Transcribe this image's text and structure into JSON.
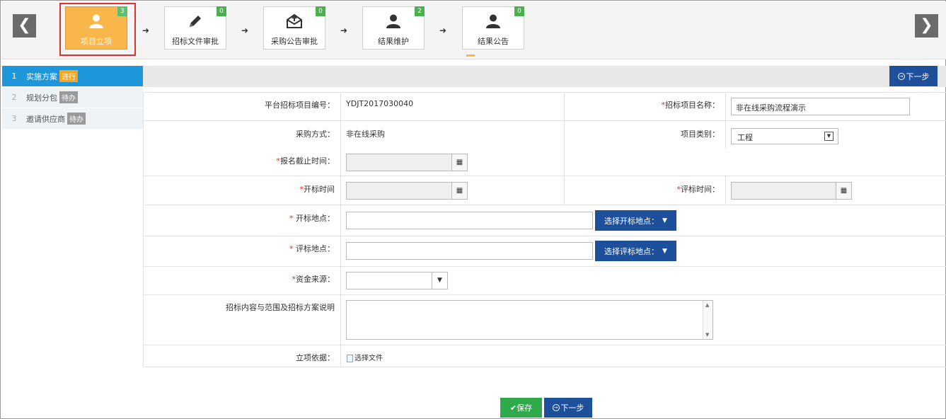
{
  "nav": {
    "prev": "❮",
    "next": "❯"
  },
  "steps": [
    {
      "label": "项目立项",
      "badge": "3",
      "icon": "user-icon",
      "active": true
    },
    {
      "label": "招标文件审批",
      "badge": "0",
      "icon": "pencil-icon",
      "active": false
    },
    {
      "label": "采购公告审批",
      "badge": "0",
      "icon": "envelope-icon",
      "active": false
    },
    {
      "label": "结果维护",
      "badge": "2",
      "icon": "user-icon",
      "active": false
    },
    {
      "label": "结果公告",
      "badge": "0",
      "icon": "user-icon",
      "active": false
    }
  ],
  "step_arrow": "➜",
  "sidebar": {
    "items": [
      {
        "num": "1",
        "label": "实施方案",
        "status": "进行",
        "active": true
      },
      {
        "num": "2",
        "label": "规划分包",
        "status": "待办",
        "active": false
      },
      {
        "num": "3",
        "label": "邀请供应商",
        "status": "待办",
        "active": false
      }
    ]
  },
  "actions": {
    "next": "下一步",
    "save": "保存",
    "next_icon": "→",
    "save_icon": "✔"
  },
  "form": {
    "project_no": {
      "label": "平台招标项目编号：",
      "value": "YDJT2017030040"
    },
    "project_name": {
      "label": "招标项目名称：",
      "value": "非在线采购流程演示"
    },
    "purchase_method": {
      "label": "采购方式：",
      "value": "非在线采购"
    },
    "project_type": {
      "label": "项目类别：",
      "value": "工程"
    },
    "signup_deadline": {
      "label": "报名截止时间：",
      "value": ""
    },
    "open_time": {
      "label": "开标时间",
      "value": ""
    },
    "eval_time": {
      "label": "评标时间：",
      "value": ""
    },
    "open_place": {
      "label": " 开标地点：",
      "value": "",
      "button": "选择开标地点："
    },
    "eval_place": {
      "label": " 评标地点：",
      "value": "",
      "button": "选择评标地点："
    },
    "fund_source": {
      "label": "资金来源：",
      "value": ""
    },
    "scope": {
      "label": "招标内容与范围及招标方案说明",
      "value": ""
    },
    "basis": {
      "label": "立项依据：",
      "file_button": "选择文件"
    },
    "required_mark": "*"
  },
  "colors": {
    "active_step": "#f8b64b",
    "badge": "#4caf50",
    "sidebar_active": "#1e96dc",
    "primary_button": "#1e4f9a",
    "save_button": "#2eaa4a",
    "required": "#e03030"
  }
}
